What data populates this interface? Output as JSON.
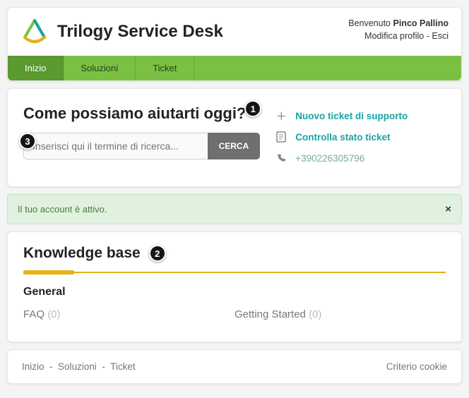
{
  "brand": {
    "title": "Trilogy Service Desk"
  },
  "user": {
    "welcome_prefix": "Benvenuto",
    "name": "Pinco Pallino",
    "edit_profile": "Modifica profilo",
    "separator": "-",
    "logout": "Esci"
  },
  "nav": {
    "home": "Inizio",
    "solutions": "Soluzioni",
    "tickets": "Ticket"
  },
  "main": {
    "heading": "Come possiamo aiutarti oggi?",
    "search_placeholder": "Inserisci qui il termine di ricerca...",
    "search_button": "CERCA"
  },
  "quick_links": {
    "new_ticket": "Nuovo ticket di supporto",
    "check_status": "Controlla stato ticket",
    "phone": "+390226305796"
  },
  "status": {
    "message": "Il tuo account è attivo."
  },
  "kb": {
    "title": "Knowledge base",
    "section": "General",
    "col1_label": "FAQ",
    "col1_count": "(0)",
    "col2_label": "Getting Started",
    "col2_count": "(0)"
  },
  "footer": {
    "home": "Inizio",
    "solutions": "Soluzioni",
    "tickets": "Ticket",
    "cookie": "Criterio cookie"
  },
  "callouts": {
    "one": "1",
    "two": "2",
    "three": "3"
  }
}
